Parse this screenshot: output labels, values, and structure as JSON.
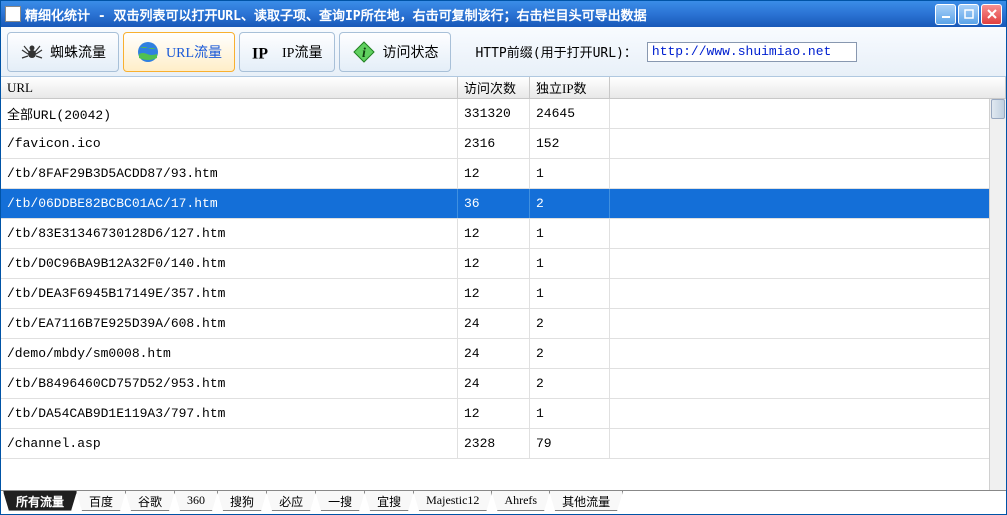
{
  "window": {
    "title": "精细化统计 - 双击列表可以打开URL、读取子项、查询IP所在地，右击可复制该行；右击栏目头可导出数据"
  },
  "toolbar": {
    "tabs": [
      {
        "label": "蜘蛛流量",
        "icon": "spider",
        "active": false
      },
      {
        "label": "URL流量",
        "icon": "globe",
        "active": true
      },
      {
        "label": "IP流量",
        "icon": "ip",
        "active": false
      },
      {
        "label": "访问状态",
        "icon": "info",
        "active": false
      }
    ],
    "http_prefix_label": "HTTP前缀(用于打开URL)：",
    "http_prefix_value": "http://www.shuimiao.net"
  },
  "table": {
    "headers": {
      "url": "URL",
      "visits": "访问次数",
      "ips": "独立IP数"
    },
    "selected_index": 3,
    "rows": [
      {
        "url": "全部URL(20042)",
        "visits": "331320",
        "ips": "24645"
      },
      {
        "url": "/favicon.ico",
        "visits": "2316",
        "ips": "152"
      },
      {
        "url": "/tb/8FAF29B3D5ACDD87/93.htm",
        "visits": "12",
        "ips": "1"
      },
      {
        "url": "/tb/06DDBE82BCBC01AC/17.htm",
        "visits": "36",
        "ips": "2"
      },
      {
        "url": "/tb/83E31346730128D6/127.htm",
        "visits": "12",
        "ips": "1"
      },
      {
        "url": "/tb/D0C96BA9B12A32F0/140.htm",
        "visits": "12",
        "ips": "1"
      },
      {
        "url": "/tb/DEA3F6945B17149E/357.htm",
        "visits": "12",
        "ips": "1"
      },
      {
        "url": "/tb/EA7116B7E925D39A/608.htm",
        "visits": "24",
        "ips": "2"
      },
      {
        "url": "/demo/mbdy/sm0008.htm",
        "visits": "24",
        "ips": "2"
      },
      {
        "url": "/tb/B8496460CD757D52/953.htm",
        "visits": "24",
        "ips": "2"
      },
      {
        "url": "/tb/DA54CAB9D1E119A3/797.htm",
        "visits": "12",
        "ips": "1"
      },
      {
        "url": "/channel.asp",
        "visits": "2328",
        "ips": "79"
      }
    ]
  },
  "bottom_tabs": {
    "active_index": 0,
    "items": [
      "所有流量",
      "百度",
      "谷歌",
      "360",
      "搜狗",
      "必应",
      "一搜",
      "宜搜",
      "Majestic12",
      "Ahrefs",
      "其他流量"
    ]
  }
}
